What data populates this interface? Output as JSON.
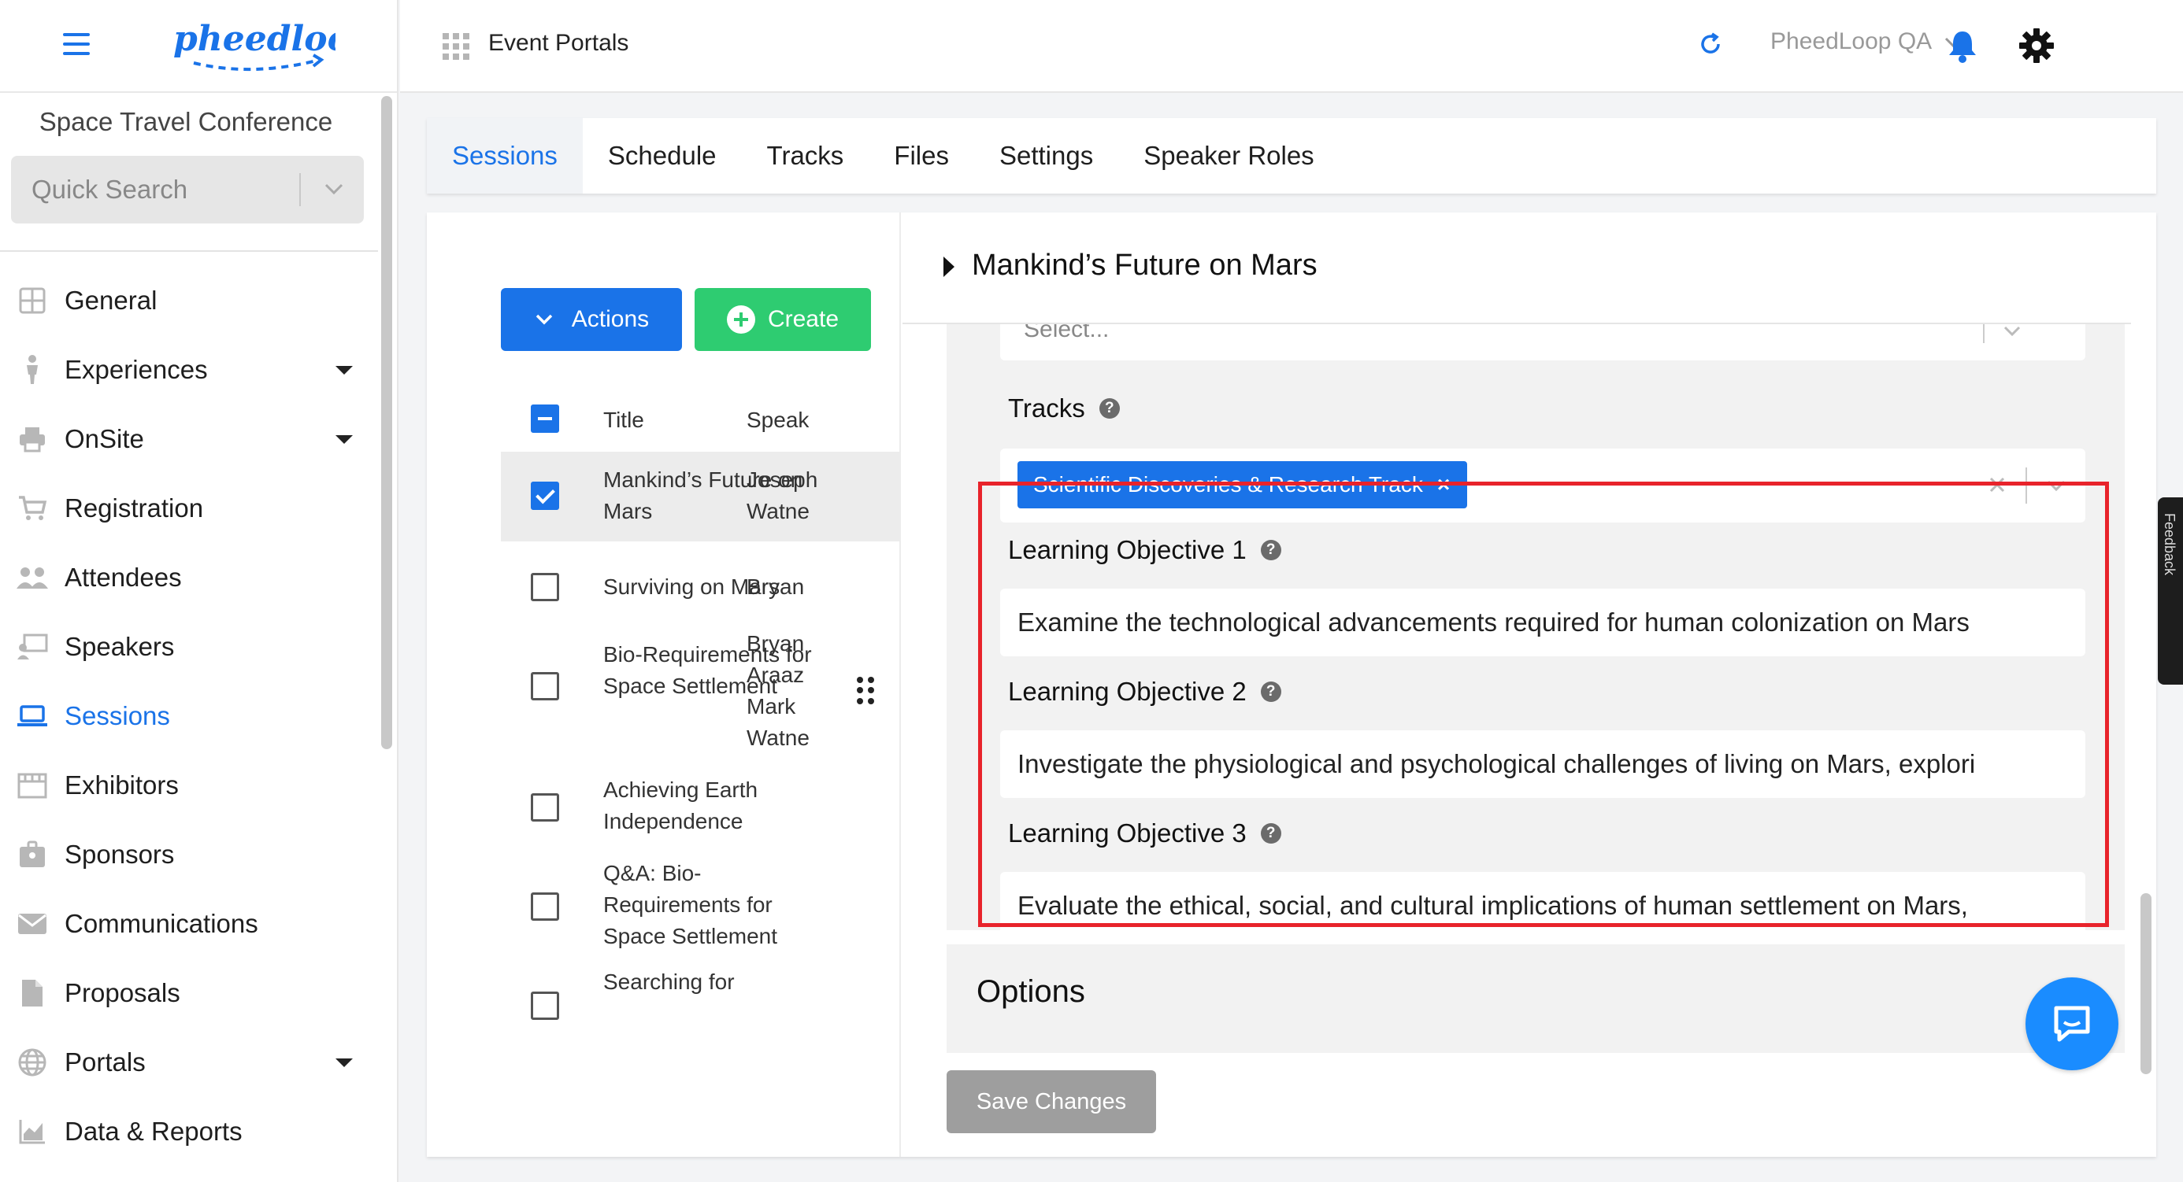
{
  "sidebar": {
    "event_name": "Space Travel Conference",
    "quick_search_placeholder": "Quick Search",
    "items": [
      {
        "label": "General",
        "icon": "grid-icon"
      },
      {
        "label": "Experiences",
        "icon": "person-icon",
        "expandable": true
      },
      {
        "label": "OnSite",
        "icon": "printer-icon",
        "expandable": true
      },
      {
        "label": "Registration",
        "icon": "cart-icon"
      },
      {
        "label": "Attendees",
        "icon": "people-icon"
      },
      {
        "label": "Speakers",
        "icon": "presenter-icon"
      },
      {
        "label": "Sessions",
        "icon": "laptop-icon",
        "active": true
      },
      {
        "label": "Exhibitors",
        "icon": "booth-icon"
      },
      {
        "label": "Sponsors",
        "icon": "badge-icon"
      },
      {
        "label": "Communications",
        "icon": "mail-icon"
      },
      {
        "label": "Proposals",
        "icon": "document-icon"
      },
      {
        "label": "Portals",
        "icon": "globe-icon",
        "expandable": true
      },
      {
        "label": "Data & Reports",
        "icon": "chart-icon"
      }
    ]
  },
  "topbar": {
    "portal_title": "Event Portals",
    "account_name": "PheedLoop QA"
  },
  "tabs": [
    "Sessions",
    "Schedule",
    "Tracks",
    "Files",
    "Settings",
    "Speaker Roles"
  ],
  "list": {
    "actions_label": "Actions",
    "create_label": "Create",
    "col_title": "Title",
    "col_speaker": "Speak",
    "rows": [
      {
        "title": "Mankind’s Future on Mars",
        "speaker": "Joseph\nWatne",
        "checked": true
      },
      {
        "title": "Surviving on Mars",
        "speaker": "Bryan",
        "checked": false
      },
      {
        "title": "Bio-Requirements for Space Settlement",
        "speaker": "Bryan\nAraaz\nMark\nWatne",
        "checked": false
      },
      {
        "title": "Achieving Earth Independence",
        "speaker": "",
        "checked": false
      },
      {
        "title": "Q&A: Bio-Requirements for Space Settlement",
        "speaker": "",
        "checked": false
      },
      {
        "title": "Searching for",
        "speaker": "",
        "checked": false
      }
    ]
  },
  "detail": {
    "title": "Mankind’s Future on Mars",
    "select_placeholder": "Select...",
    "tracks_label": "Tracks",
    "track_chip": "Scientific Discoveries & Research Track",
    "objectives": [
      {
        "label": "Learning Objective 1",
        "value": "Examine the technological advancements required for human colonization on Mars"
      },
      {
        "label": "Learning Objective 2",
        "value": "Investigate the physiological and psychological challenges of living on Mars, explori"
      },
      {
        "label": "Learning Objective 3",
        "value": "Evaluate the ethical, social, and cultural implications of human settlement on Mars,"
      }
    ],
    "options_title": "Options",
    "save_label": "Save Changes"
  },
  "feedback_label": "Feedback",
  "colors": {
    "accent": "#1a73e8",
    "create": "#2ecc71",
    "highlight": "#e8232b"
  }
}
